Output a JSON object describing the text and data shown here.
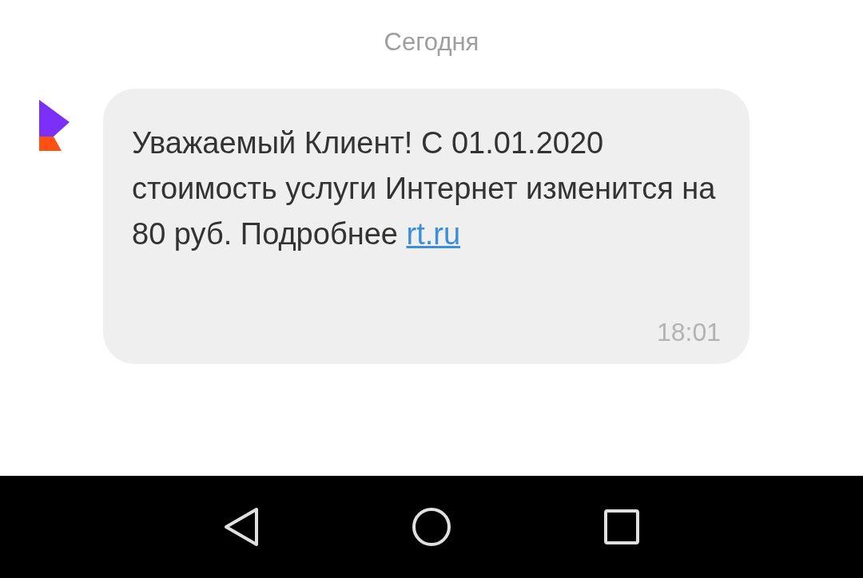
{
  "date_separator": "Сегодня",
  "message": {
    "text": "Уважаемый Клиент! С 01.01.2020 стоимость услуги Интернет изменится на 80 руб. Подробнее",
    "link": "rt.ru",
    "time": "18:01"
  }
}
